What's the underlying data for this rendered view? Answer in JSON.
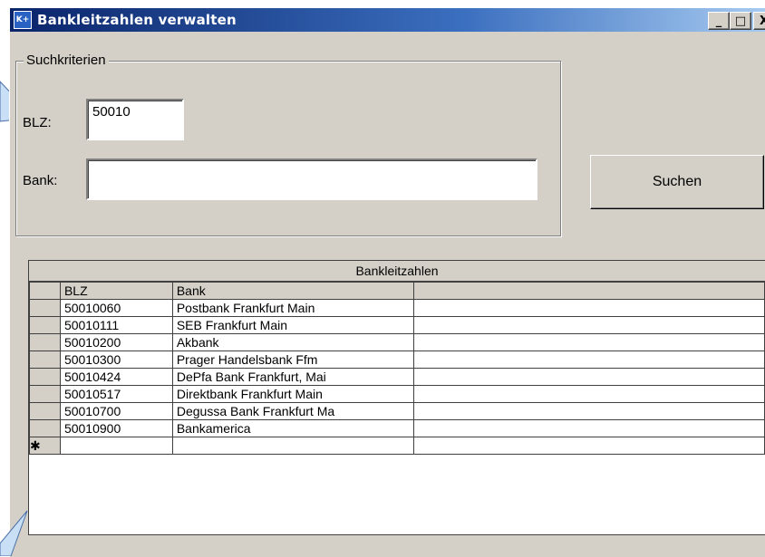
{
  "window": {
    "title": "Bankleitzahlen verwalten",
    "icon_label": "K+",
    "title_gradient_start": "#0a246a",
    "title_gradient_end": "#a6caf0"
  },
  "window_controls": {
    "minimize": "_",
    "maximize": "□",
    "close": "X"
  },
  "search": {
    "group_label": "Suchkriterien",
    "blz_label": "BLZ:",
    "blz_value": "50010",
    "bank_label": "Bank:",
    "bank_value": "",
    "search_button": "Suchen"
  },
  "grid": {
    "caption": "Bankleitzahlen",
    "columns": [
      "BLZ",
      "Bank",
      ""
    ],
    "rows": [
      {
        "blz": "50010060",
        "bank": "Postbank Frankfurt Main"
      },
      {
        "blz": "50010111",
        "bank": "SEB Frankfurt Main"
      },
      {
        "blz": "50010200",
        "bank": "Akbank"
      },
      {
        "blz": "50010300",
        "bank": "Prager Handelsbank Ffm"
      },
      {
        "blz": "50010424",
        "bank": "DePfa Bank Frankfurt, Mai"
      },
      {
        "blz": "50010517",
        "bank": "Direktbank Frankfurt Main"
      },
      {
        "blz": "50010700",
        "bank": "Degussa Bank Frankfurt Ma"
      },
      {
        "blz": "50010900",
        "bank": "Bankamerica"
      }
    ],
    "new_row_marker": "✱"
  },
  "callout_color": "#c8dff5"
}
